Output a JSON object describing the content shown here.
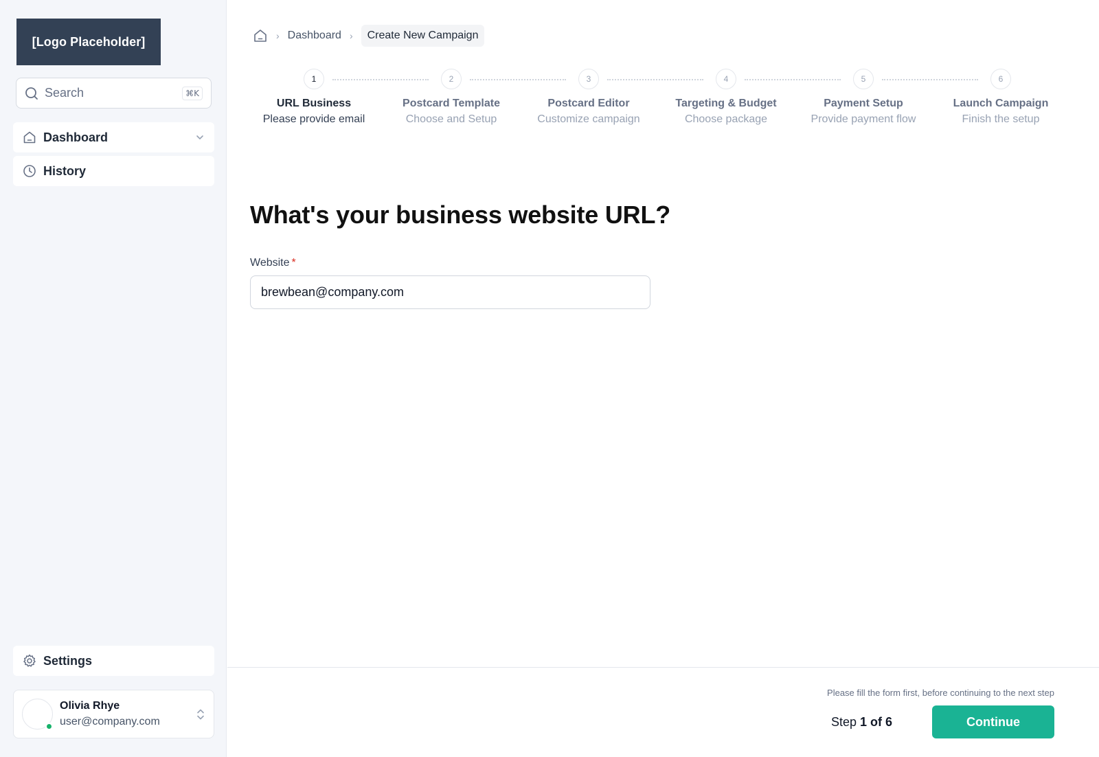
{
  "brand": {
    "logo_text": "[Logo Placeholder]"
  },
  "search": {
    "placeholder": "Search",
    "shortcut": "⌘K"
  },
  "nav": {
    "dashboard": "Dashboard",
    "history": "History",
    "settings": "Settings"
  },
  "user": {
    "name": "Olivia Rhye",
    "email": "user@company.com",
    "status": "online"
  },
  "breadcrumb": {
    "home_icon": "home-icon",
    "items": [
      "Dashboard",
      "Create New Campaign"
    ]
  },
  "steps": [
    {
      "number": "1",
      "title": "URL Business",
      "subtitle": "Please provide email",
      "active": true
    },
    {
      "number": "2",
      "title": "Postcard Template",
      "subtitle": "Choose and Setup",
      "active": false
    },
    {
      "number": "3",
      "title": "Postcard Editor",
      "subtitle": "Customize campaign",
      "active": false
    },
    {
      "number": "4",
      "title": "Targeting & Budget",
      "subtitle": "Choose package",
      "active": false
    },
    {
      "number": "5",
      "title": "Payment Setup",
      "subtitle": "Provide payment flow",
      "active": false
    },
    {
      "number": "6",
      "title": "Launch Campaign",
      "subtitle": "Finish the setup",
      "active": false
    }
  ],
  "form": {
    "heading": "What's your business website URL?",
    "label": "Website",
    "required_mark": "*",
    "value": "brewbean@company.com"
  },
  "footer": {
    "hint": "Please fill the form first, before continuing to the next step",
    "step_prefix": "Step",
    "step_current": "1 of 6",
    "continue_label": "Continue"
  },
  "colors": {
    "accent": "#1ab394",
    "logo_bg": "#334155",
    "online": "#17b26a",
    "required": "#d92d20"
  }
}
